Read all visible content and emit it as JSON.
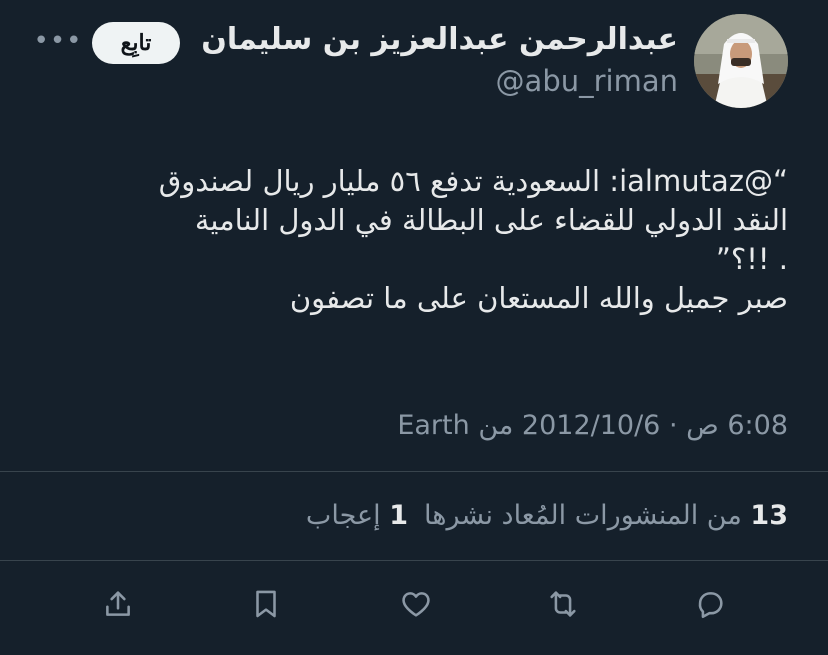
{
  "user": {
    "name": "عبدالرحمن عبدالعزيز بن سليمان",
    "handle": "@abu_riman",
    "follow_label": "تابِع",
    "more_label": "•••"
  },
  "tweet": {
    "lines": [
      "“@ialmutaz: السعودية تدفع ٥٦ مليار ريال لصندوق",
      "النقد الدولي للقضاء على البطالة في الدول النامية",
      ". !!؟”",
      "صبر جميل والله المستعان على ما تصفون"
    ],
    "meta": "6:08 ص · 2012/10/6 من Earth"
  },
  "stats": {
    "retweets_count": "13",
    "retweets_label": "من المنشورات المُعاد نشرها",
    "likes_count": "1",
    "likes_label": "إعجاب"
  },
  "actions": {
    "icons": [
      "reply-icon",
      "retweet-icon",
      "like-icon",
      "bookmark-icon",
      "share-icon"
    ]
  },
  "colors": {
    "background": "#15202b",
    "text": "#e7e9ea",
    "secondary": "#8b98a5",
    "divider": "#38444d"
  }
}
